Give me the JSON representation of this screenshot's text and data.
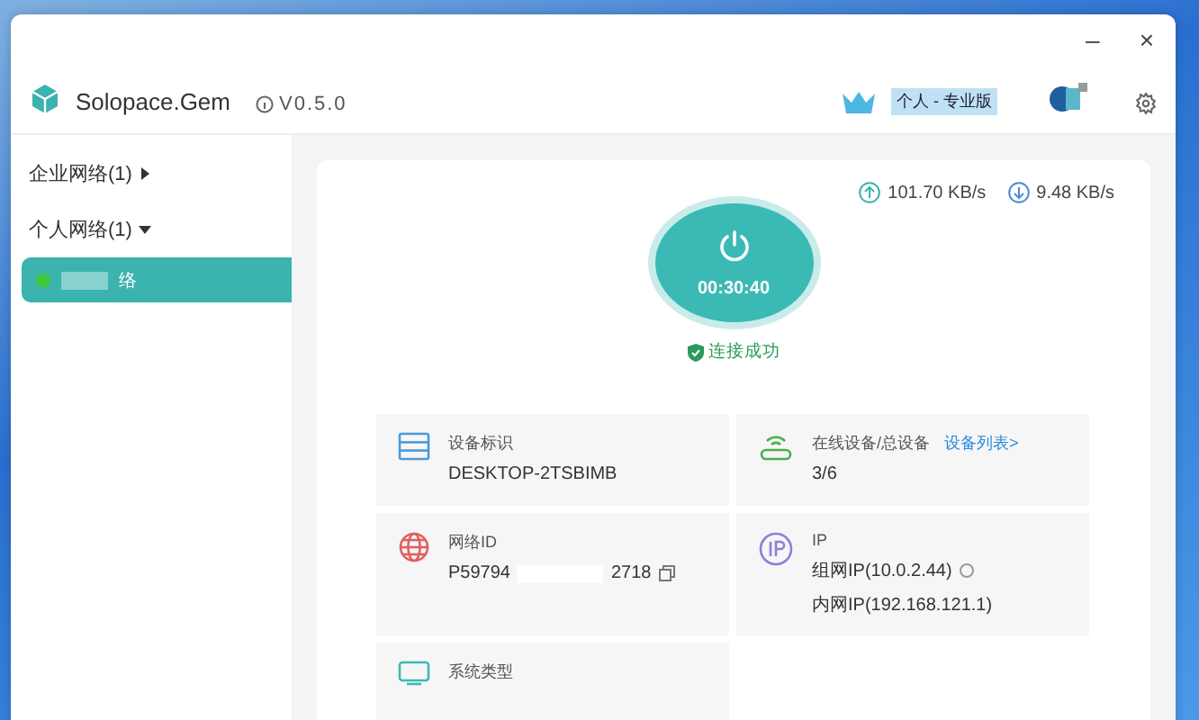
{
  "window": {
    "app_name": "Solopace.Gem",
    "version": "V0.5.0",
    "plan": "个人 - 专业版",
    "controls": [
      "–",
      "×"
    ]
  },
  "sidebar": {
    "groups": [
      {
        "label": "企业网络(1)",
        "expanded": false
      },
      {
        "label": "个人网络(1)",
        "expanded": true,
        "children": [
          {
            "label": "络",
            "selected": true,
            "color": "#3cc83c"
          }
        ]
      }
    ]
  },
  "speeds": {
    "upload": "101.70 KB/s",
    "download": "9.48 KB/s"
  },
  "connection": {
    "timer": "00:30:40",
    "status": "连接成功",
    "connected": true
  },
  "cards": [
    {
      "kind": "device",
      "label": "设备标识",
      "value": "DESKTOP-2TSBIMB"
    },
    {
      "kind": "online",
      "label": "在线设备/总设备",
      "link": "设备列表>",
      "value": "3/6"
    },
    {
      "kind": "netid",
      "label": "网络ID",
      "value": "P59794",
      "value_end": "2718"
    },
    {
      "kind": "ip",
      "label": "IP",
      "lines": [
        "组网IP(10.0.2.44)",
        "内网IP(192.168.121.1)"
      ]
    },
    {
      "kind": "os",
      "label": "系统类型"
    }
  ]
}
